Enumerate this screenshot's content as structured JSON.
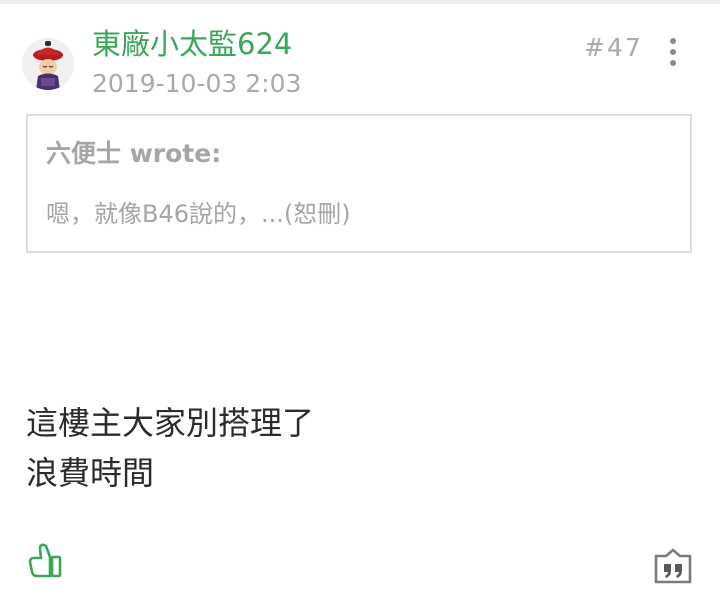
{
  "post": {
    "author": "東廠小太監624",
    "date": "2019-10-03 2:03",
    "floor": "#47",
    "quote": {
      "author_line": "六便士 wrote:",
      "text": "嗯，就像B46說的，...(恕刪)"
    },
    "content_lines": [
      "這樓主大家別搭理了",
      "浪費時間"
    ]
  },
  "icons": {
    "avatar": "eunuch-avatar-icon",
    "more": "more-vertical-icon",
    "like": "thumbs-up-icon",
    "reply": "quote-reply-icon"
  },
  "colors": {
    "author": "#3aa757",
    "meta": "#a9a9a9",
    "quote_border": "#dddddd",
    "body_text": "#2b2b2b"
  }
}
